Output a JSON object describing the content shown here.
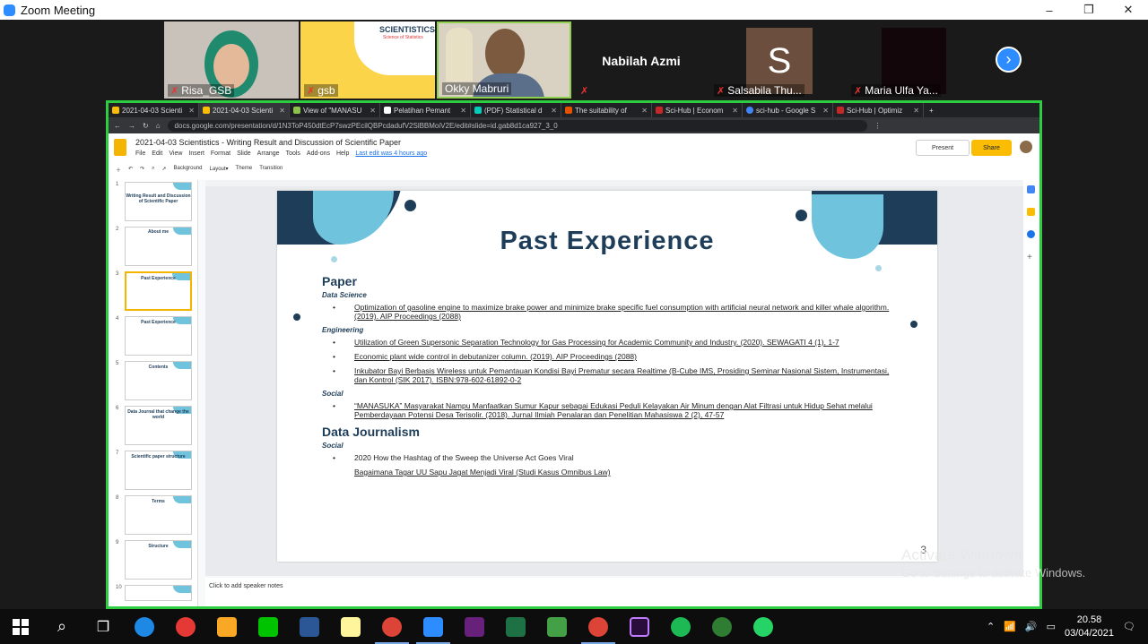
{
  "window": {
    "title": "Zoom Meeting",
    "min": "–",
    "max": "❐",
    "close": "✕"
  },
  "participants": [
    {
      "name": "Risa_GSB"
    },
    {
      "name": "gsb",
      "banner": "SCIENTISTICS",
      "banner_sub": "Science of Statistics"
    },
    {
      "name": "Okky Mabruri"
    },
    {
      "name": "Nabilah Azmi"
    },
    {
      "name": "Salsabila Thu...",
      "initial": "S"
    },
    {
      "name": "Maria Ulfa Ya..."
    }
  ],
  "browser": {
    "tabs": [
      "2021-04-03 Scienti",
      "2021-04-03 Scienti",
      "View of \"MANASU",
      "Pelatihan Pemant",
      "(PDF) Statistical d",
      "The suitability of",
      "Sci-Hub | Econom",
      "sci-hub - Google S",
      "Sci-Hub | Optimiz"
    ],
    "url": "docs.google.com/presentation/d/1N3ToP450dtEcP7swzPEcilQBPcdadufV2SlBBMoiV2E/edit#slide=id.gab8d1ca927_3_0"
  },
  "docs": {
    "title": "2021-04-03 Scientistics - Writing Result and Discussion of Scientific Paper",
    "menus": [
      "File",
      "Edit",
      "View",
      "Insert",
      "Format",
      "Slide",
      "Arrange",
      "Tools",
      "Add-ons",
      "Help"
    ],
    "last_edit": "Last edit was 4 hours ago",
    "present": "Present",
    "share": "Share",
    "tools": [
      "Background",
      "Layout▾",
      "Theme",
      "Transition"
    ],
    "notes": "Click to add speaker notes",
    "thumbs": [
      {
        "n": "1",
        "t": "Writing Result and Discussion of Scientific Paper"
      },
      {
        "n": "2",
        "t": "About me"
      },
      {
        "n": "3",
        "t": "Past Experience"
      },
      {
        "n": "4",
        "t": "Past Experience"
      },
      {
        "n": "5",
        "t": "Contents"
      },
      {
        "n": "6",
        "t": "Data Journal that change the world"
      },
      {
        "n": "7",
        "t": "Scientific paper structure"
      },
      {
        "n": "8",
        "t": "Terms"
      },
      {
        "n": "9",
        "t": "Structure"
      },
      {
        "n": "10",
        "t": ""
      }
    ]
  },
  "slide": {
    "title": "Past Experience",
    "page": "3",
    "paper_heading": "Paper",
    "data_science": "Data Science",
    "ds_items": [
      "Optimization of gasoline engine to maximize brake power and minimize brake specific fuel consumption with artificial neural network and killer whale algorithm. (2019). AIP Proceedings (2088)"
    ],
    "engineering": "Engineering",
    "eng_items": [
      "Utilization of Green Supersonic Separation Technology for Gas Processing for Academic Community and Industry. (2020). SEWAGATI 4 (1), 1-7",
      "Economic plant wide control in debutanizer column. (2019). AIP Proceedings (2088)",
      "Inkubator Bayi Berbasis Wireless untuk Pemantauan Kondisi Bayi Prematur secara Realtime (B-Cube IMS, Prosiding Seminar Nasional Sistem, Instrumentasi, dan Kontrol (SIK 2017). ISBN:978-602-61892-0-2"
    ],
    "social": "Social",
    "soc_items": [
      "“MANASUKA” Masyarakat Nampu Manfaatkan Sumur Kapur sebagai Edukasi Peduli Kelayakan Air Minum dengan Alat Filtrasi untuk Hidup Sehat melalui Pemberdayaan Potensi Desa Terisolir. (2018). Jurnal Ilmiah Penalaran dan Penelitian Mahasiswa 2 (2), 47-57"
    ],
    "dj_heading": "Data Journalism",
    "dj_social": "Social",
    "dj_item1": "2020 How the Hashtag of the Sweep the Universe Act Goes Viral",
    "dj_item2": "Bagaimana Tagar UU Sapu Jagat Menjadi Viral (Studi Kasus Omnibus Law)"
  },
  "watermark": {
    "line1": "Activate Windows",
    "line2": "Go to Settings to activate Windows."
  },
  "taskbar": {
    "time": "20.58",
    "date": "03/04/2021"
  },
  "colors": {
    "accent_green": "#2ecc40",
    "slide_navy": "#1e3d59",
    "slide_light_blue": "#6fc3dd",
    "zoom_blue": "#2d8cff"
  }
}
